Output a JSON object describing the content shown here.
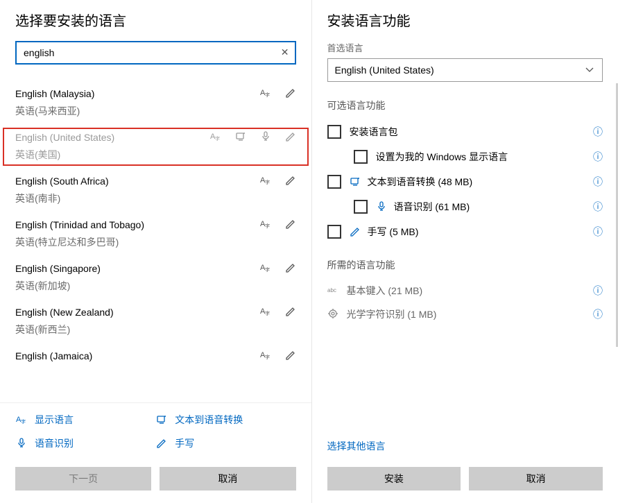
{
  "left": {
    "title": "选择要安装的语言",
    "search_value": "english",
    "clear_icon": "✕",
    "languages": [
      {
        "primary": "English (Malaysia)",
        "secondary": "英语(马来西亚)",
        "icons": [
          "display",
          "handwriting"
        ],
        "highlighted": false
      },
      {
        "primary": "English (United States)",
        "secondary": "英语(美国)",
        "icons": [
          "display",
          "tts",
          "speech",
          "handwriting"
        ],
        "highlighted": true
      },
      {
        "primary": "English (South Africa)",
        "secondary": "英语(南非)",
        "icons": [
          "display",
          "handwriting"
        ],
        "highlighted": false
      },
      {
        "primary": "English (Trinidad and Tobago)",
        "secondary": "英语(特立尼达和多巴哥)",
        "icons": [
          "display",
          "handwriting"
        ],
        "highlighted": false
      },
      {
        "primary": "English (Singapore)",
        "secondary": "英语(新加坡)",
        "icons": [
          "display",
          "handwriting"
        ],
        "highlighted": false
      },
      {
        "primary": "English (New Zealand)",
        "secondary": "英语(新西兰)",
        "icons": [
          "display",
          "handwriting"
        ],
        "highlighted": false
      },
      {
        "primary": "English (Jamaica)",
        "secondary": "",
        "icons": [
          "display",
          "handwriting"
        ],
        "highlighted": false
      }
    ],
    "legend": {
      "display": "显示语言",
      "tts": "文本到语音转换",
      "speech": "语音识别",
      "handwriting": "手写"
    },
    "buttons": {
      "next": "下一页",
      "cancel": "取消"
    }
  },
  "right": {
    "title": "安装语言功能",
    "preferred_label": "首选语言",
    "preferred_value": "English (United States)",
    "optional_header": "可选语言功能",
    "features": [
      {
        "label": "安装语言包",
        "icon": "",
        "sub": false,
        "info": true
      },
      {
        "label": "设置为我的 Windows 显示语言",
        "icon": "",
        "sub": true,
        "info": true
      },
      {
        "label": "文本到语音转换 (48 MB)",
        "icon": "tts",
        "sub": false,
        "info": true
      },
      {
        "label": "语音识别 (61 MB)",
        "icon": "speech",
        "sub": true,
        "info": true
      },
      {
        "label": "手写 (5 MB)",
        "icon": "handwriting",
        "sub": false,
        "info": true
      }
    ],
    "required_header": "所需的语言功能",
    "required": [
      {
        "label": "基本键入 (21 MB)",
        "icon": "abc"
      },
      {
        "label": "光学字符识别 (1 MB)",
        "icon": "ocr"
      }
    ],
    "link": "选择其他语言",
    "buttons": {
      "install": "安装",
      "cancel": "取消"
    }
  },
  "icons": {
    "display": "A字",
    "tts": "tts",
    "speech": "mic",
    "handwriting": "pen",
    "abc": "abc",
    "ocr": "ocr",
    "info": "ⓘ",
    "chevron_down": "⌄"
  }
}
